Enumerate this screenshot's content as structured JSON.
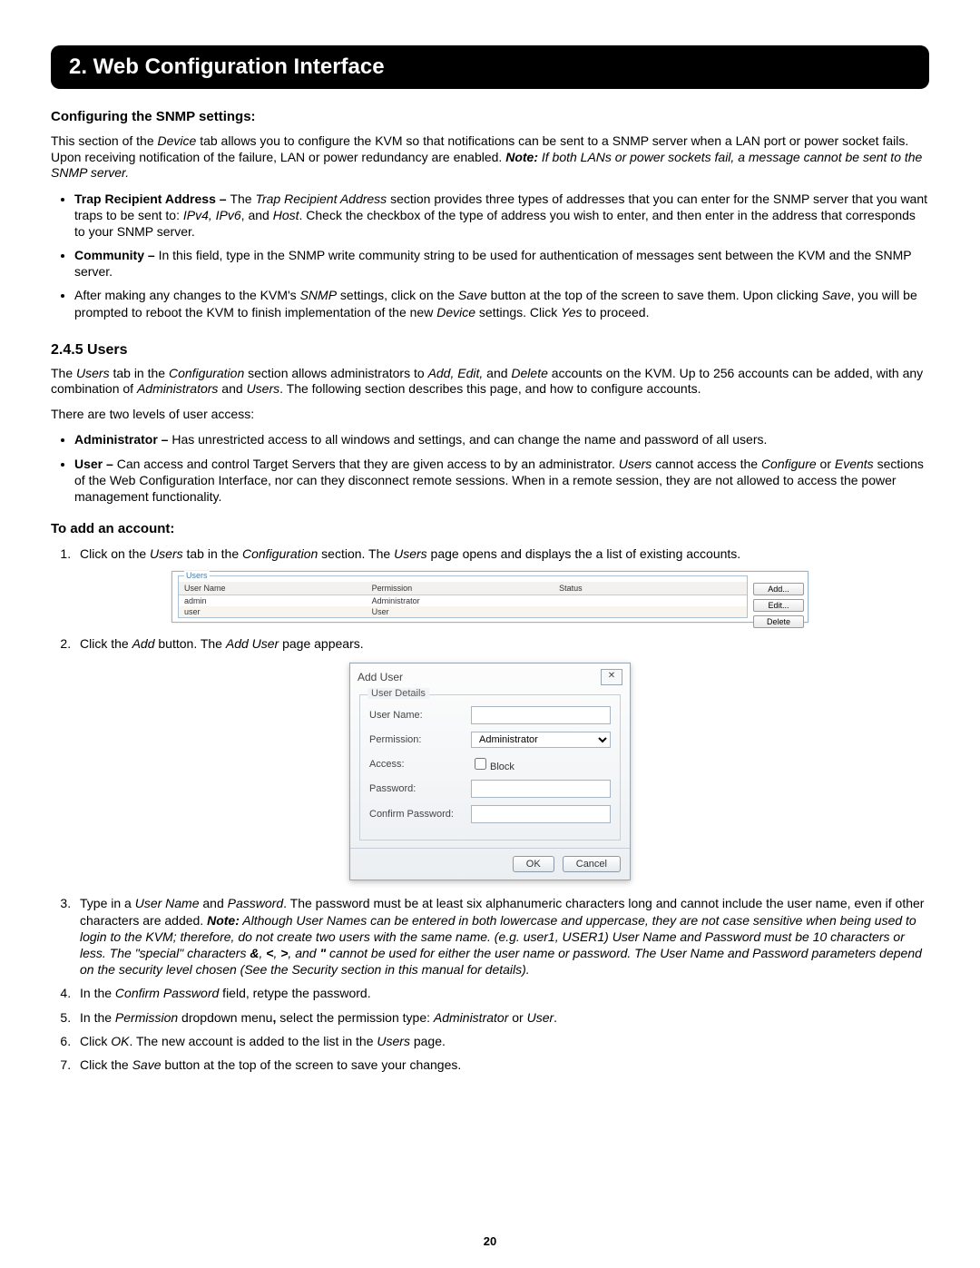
{
  "header": {
    "title": "2. Web Configuration Interface"
  },
  "snmp": {
    "heading": "Configuring the SNMP settings:",
    "intro_plain": "This section of the ",
    "intro_device": "Device",
    "intro_rest": " tab allows you to configure the KVM so that notifications can be sent to a SNMP server when a LAN port or power socket fails. Upon receiving notification of the failure, LAN or power redundancy are enabled. ",
    "intro_note_label": "Note:",
    "intro_note": " If both LANs or power sockets fail, a message cannot be sent to the SNMP server.",
    "b1_label": "Trap Recipient Address – ",
    "b1_a": "The ",
    "b1_i": "Trap Recipient Address",
    "b1_b": " section provides three types of addresses that you can enter for the SNMP server that you want traps to be sent to: ",
    "b1_c": "IPv4, IPv6",
    "b1_d": ", and ",
    "b1_e": "Host",
    "b1_f": ". Check the checkbox of the type of address you wish to enter, and then enter in the address that corresponds to your SNMP server.",
    "b2_label": "Community – ",
    "b2": "In this field, type in the SNMP write community string to be used for authentication of messages sent between the KVM and the SNMP server.",
    "b3_a": "After making any changes to the KVM's ",
    "b3_b": "SNMP",
    "b3_c": " settings, click on the ",
    "b3_d": "Save",
    "b3_e": " button at the top of the screen to save them. Upon clicking ",
    "b3_f": "Save",
    "b3_g": ", you will be prompted to reboot the KVM to finish implementation of the new ",
    "b3_h": "Device",
    "b3_i": " settings. Click ",
    "b3_j": "Yes",
    "b3_k": " to proceed."
  },
  "users": {
    "heading": "2.4.5 Users",
    "p1_a": "The ",
    "p1_b": "Users",
    "p1_c": " tab in the ",
    "p1_d": "Configuration",
    "p1_e": " section allows administrators to ",
    "p1_f": "Add, Edit,",
    "p1_g": " and ",
    "p1_h": "Delete",
    "p1_i": " accounts on the KVM. Up to 256 accounts can be added, with any combination of ",
    "p1_j": "Administrators",
    "p1_k": " and ",
    "p1_l": "Users",
    "p1_m": ". The following section describes this page, and how to configure accounts.",
    "p2": "There are two levels of user access:",
    "admin_label": "Administrator – ",
    "admin_text": "Has unrestricted access to all windows and settings, and can change the name and password of all users.",
    "user_label": "User – ",
    "user_a": "Can access and control Target Servers that they are given access to by an administrator. ",
    "user_b": "Users",
    "user_c": " cannot access the ",
    "user_d": "Configure",
    "user_e": " or ",
    "user_f": "Events",
    "user_g": " sections of the Web Configuration Interface, nor can they disconnect remote sessions. When in a remote session, they are not allowed to access the power management functionality."
  },
  "add": {
    "heading": "To add an account:",
    "s1_a": "Click on the ",
    "s1_b": "Users",
    "s1_c": " tab in the ",
    "s1_d": "Configuration",
    "s1_e": " section. The ",
    "s1_f": "Users",
    "s1_g": " page opens and displays the a list of existing accounts.",
    "s2_a": "Click the ",
    "s2_b": "Add",
    "s2_c": " button. The ",
    "s2_d": "Add User",
    "s2_e": " page appears.",
    "s3_a": "Type in a ",
    "s3_b": "User Name",
    "s3_c": " and ",
    "s3_d": "Password",
    "s3_e": ". The password must be at least six alphanumeric characters long and cannot include the user name, even if other characters are added. ",
    "s3_note_label": "Note:",
    "s3_note": " Although User Names can be entered in both lowercase and uppercase, they are not case sensitive when being used to login to the KVM; therefore, do not create two users with the same name. (e.g. user1, USER1) User Name and Password must be 10 characters or less. The \"special\" characters ",
    "s3_special1": "&",
    "s3_note2": ", ",
    "s3_special2": "<",
    "s3_note3": ", ",
    "s3_special3": ">",
    "s3_note4": ", and ",
    "s3_special4": "\"",
    "s3_note5": " cannot be used for either the user name or password. The User Name and Password parameters depend on the security level chosen (See the Security section in this manual for details).",
    "s4_a": "In the ",
    "s4_b": "Confirm Password",
    "s4_c": " field, retype the password.",
    "s5_a": "In the ",
    "s5_b": "Permission",
    "s5_c": " dropdown menu",
    "s5_comma": ",",
    "s5_d": " select the permission type: ",
    "s5_e": "Administrator",
    "s5_f": " or ",
    "s5_g": "User",
    "s5_h": ".",
    "s6_a": "Click ",
    "s6_b": "OK",
    "s6_c": ". The new account is added to the list in the ",
    "s6_d": "Users",
    "s6_e": " page.",
    "s7_a": "Click the ",
    "s7_b": "Save",
    "s7_c": " button at the top of the screen to save your changes."
  },
  "users_table": {
    "group_label": "Users",
    "columns": [
      "User Name",
      "Permission",
      "Status"
    ],
    "rows": [
      {
        "name": "admin",
        "perm": "Administrator",
        "status": ""
      },
      {
        "name": "user",
        "perm": "User",
        "status": ""
      }
    ],
    "buttons": {
      "add": "Add...",
      "edit": "Edit...",
      "delete": "Delete"
    }
  },
  "dialog": {
    "title": "Add User",
    "close": "✕",
    "fieldset": "User Details",
    "labels": {
      "username": "User Name:",
      "permission": "Permission:",
      "access": "Access:",
      "block": "Block",
      "password": "Password:",
      "confirm": "Confirm Password:"
    },
    "permission_value": "Administrator",
    "ok": "OK",
    "cancel": "Cancel"
  },
  "page_number": "20"
}
